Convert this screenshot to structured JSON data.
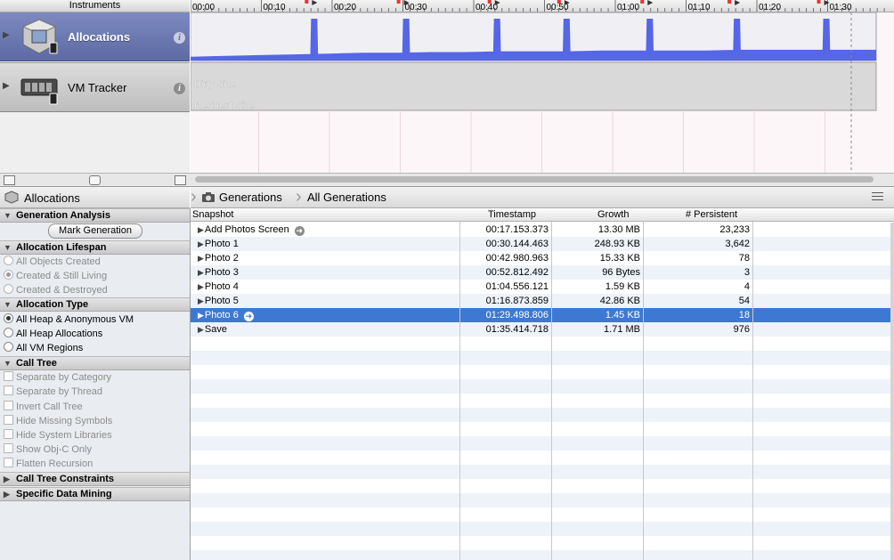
{
  "instruments_header": "Instruments",
  "ruler": {
    "ticks": [
      "00:00",
      "00:10",
      "00:20",
      "00:30",
      "00:40",
      "00:50",
      "01:00",
      "01:10",
      "01:20",
      "01:30"
    ]
  },
  "tracks": [
    {
      "name": "Allocations",
      "icon": "allocations-instrument-icon",
      "selected": true
    },
    {
      "name": "VM Tracker",
      "icon": "vm-tracker-instrument-icon",
      "selected": false
    }
  ],
  "vm_graph": {
    "dirty_label": "Dirty Size",
    "resident_label": "Resident Size"
  },
  "allocation_graph": {
    "fill_color": "#5566e8",
    "baseline": [
      5,
      6,
      7,
      8,
      9,
      10,
      10,
      11,
      11,
      12,
      12,
      12,
      13,
      13,
      13,
      13,
      14,
      14,
      14,
      14,
      14
    ],
    "spike_times_s": [
      17.15,
      30.14,
      42.98,
      52.81,
      64.56,
      76.87,
      89.5
    ],
    "spike_level": 1.0
  },
  "left_panel": {
    "header": "Allocations",
    "mark_generation_button": "Mark Generation",
    "sections": {
      "generation_analysis": "Generation Analysis",
      "allocation_lifespan": "Allocation Lifespan",
      "allocation_type": "Allocation Type",
      "call_tree": "Call Tree",
      "call_tree_constraints": "Call Tree Constraints",
      "specific_data_mining": "Specific Data Mining"
    },
    "lifespan_options": [
      "All Objects Created",
      "Created & Still Living",
      "Created & Destroyed"
    ],
    "lifespan_selected": 1,
    "type_options": [
      "All Heap & Anonymous VM",
      "All Heap Allocations",
      "All VM Regions"
    ],
    "type_selected": 0,
    "call_tree_options": [
      "Separate by Category",
      "Separate by Thread",
      "Invert Call Tree",
      "Hide Missing Symbols",
      "Hide System Libraries",
      "Show Obj-C Only",
      "Flatten Recursion"
    ]
  },
  "nav": {
    "crumb1": "Generations",
    "crumb2": "All Generations"
  },
  "table": {
    "headers": {
      "snapshot": "Snapshot",
      "timestamp": "Timestamp",
      "growth": "Growth",
      "persistent": "# Persistent"
    },
    "rows": [
      {
        "snapshot": "Add Photos Screen",
        "timestamp": "00:17.153.373",
        "growth": "13.30 MB",
        "persistent": "23,233",
        "go": true,
        "selected": false
      },
      {
        "snapshot": "Photo 1",
        "timestamp": "00:30.144.463",
        "growth": "248.93 KB",
        "persistent": "3,642",
        "go": false,
        "selected": false
      },
      {
        "snapshot": "Photo 2",
        "timestamp": "00:42.980.963",
        "growth": "15.33 KB",
        "persistent": "78",
        "go": false,
        "selected": false
      },
      {
        "snapshot": "Photo 3",
        "timestamp": "00:52.812.492",
        "growth": "96 Bytes",
        "persistent": "3",
        "go": false,
        "selected": false
      },
      {
        "snapshot": "Photo 4",
        "timestamp": "01:04.556.121",
        "growth": "1.59 KB",
        "persistent": "4",
        "go": false,
        "selected": false
      },
      {
        "snapshot": "Photo 5",
        "timestamp": "01:16.873.859",
        "growth": "42.86 KB",
        "persistent": "54",
        "go": false,
        "selected": false
      },
      {
        "snapshot": "Photo 6",
        "timestamp": "01:29.498.806",
        "growth": "1.45 KB",
        "persistent": "18",
        "go": true,
        "selected": true
      },
      {
        "snapshot": "Save",
        "timestamp": "01:35.414.718",
        "growth": "1.71 MB",
        "persistent": "976",
        "go": false,
        "selected": false
      }
    ]
  },
  "colors": {
    "selection": "#3d79d2",
    "track_selected": "#6b78b3",
    "alt_row": "#eef3fa"
  }
}
